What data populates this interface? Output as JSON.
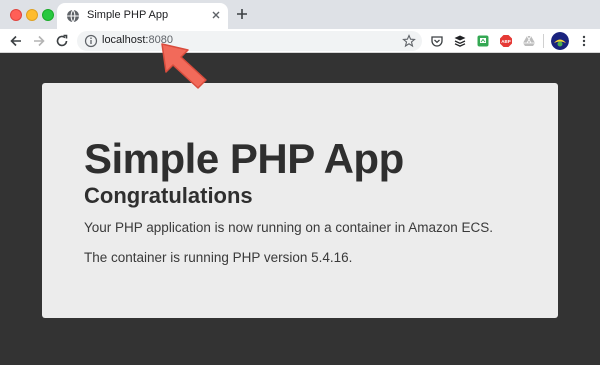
{
  "browser": {
    "tab": {
      "title": "Simple PHP App",
      "favicon": "globe-icon"
    },
    "new_tab_icon": "plus-icon",
    "url_host": "localhost:",
    "url_port": "8080",
    "extensions": [
      "pocket-icon",
      "buffer-icon",
      "green-extension-icon",
      "abp-icon",
      "drive-icon"
    ],
    "abp_label": "ABP"
  },
  "page": {
    "title": "Simple PHP App",
    "subtitle": "Congratulations",
    "paragraph_1": "Your PHP application is now running on a container in Amazon ECS.",
    "paragraph_2": "The container is running PHP version 5.4.16."
  },
  "colors": {
    "page_background": "#333333",
    "card_background": "#ececec",
    "arrow": "#f26a5a"
  }
}
